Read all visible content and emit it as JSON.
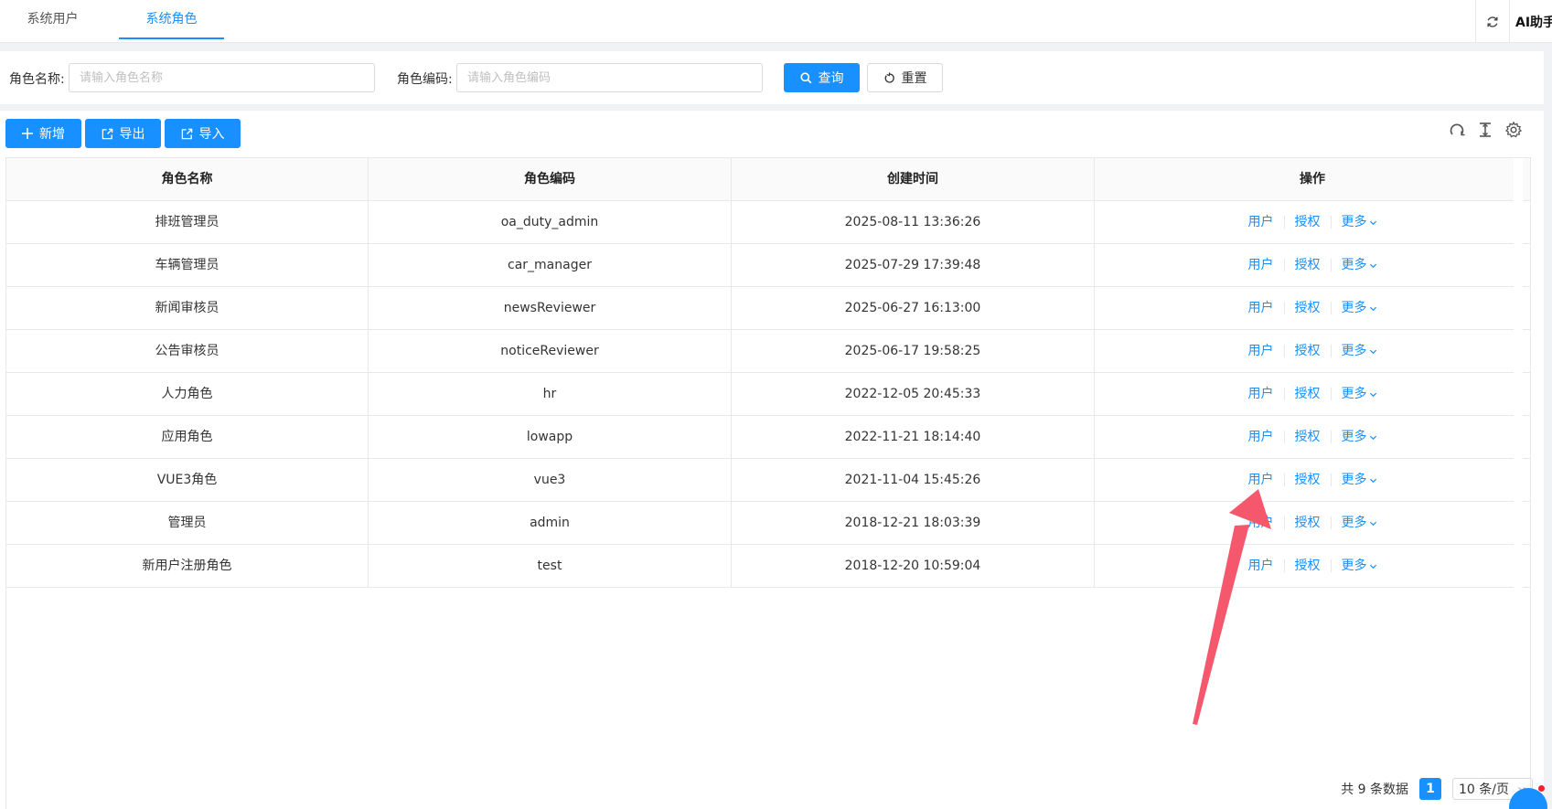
{
  "tabs": [
    {
      "label": "系统用户"
    },
    {
      "label": "系统角色"
    }
  ],
  "topbar": {
    "ai_label": "AI助手"
  },
  "search": {
    "role_name_label": "角色名称:",
    "role_name_placeholder": "请输入角色名称",
    "role_code_label": "角色编码:",
    "role_code_placeholder": "请输入角色编码",
    "query_label": "查询",
    "reset_label": "重置"
  },
  "toolbar": {
    "add_label": "新增",
    "export_label": "导出",
    "import_label": "导入"
  },
  "table": {
    "headers": [
      "角色名称",
      "角色编码",
      "创建时间",
      "操作"
    ],
    "rows": [
      {
        "name": "排班管理员",
        "code": "oa_duty_admin",
        "created": "2025-08-11 13:36:26"
      },
      {
        "name": "车辆管理员",
        "code": "car_manager",
        "created": "2025-07-29 17:39:48"
      },
      {
        "name": "新闻审核员",
        "code": "newsReviewer",
        "created": "2025-06-27 16:13:00"
      },
      {
        "name": "公告审核员",
        "code": "noticeReviewer",
        "created": "2025-06-17 19:58:25"
      },
      {
        "name": "人力角色",
        "code": "hr",
        "created": "2022-12-05 20:45:33"
      },
      {
        "name": "应用角色",
        "code": "lowapp",
        "created": "2022-11-21 18:14:40"
      },
      {
        "name": "VUE3角色",
        "code": "vue3",
        "created": "2021-11-04 15:45:26"
      },
      {
        "name": "管理员",
        "code": "admin",
        "created": "2018-12-21 18:03:39"
      },
      {
        "name": "新用户注册角色",
        "code": "test",
        "created": "2018-12-20 10:59:04"
      }
    ],
    "action_users": "用户",
    "action_auth": "授权",
    "action_more": "更多"
  },
  "pagination": {
    "total_text": "共 9 条数据",
    "current_page": "1",
    "page_size": "10 条/页"
  },
  "colors": {
    "primary": "#1890ff",
    "annotation_arrow": "#f5576c"
  }
}
